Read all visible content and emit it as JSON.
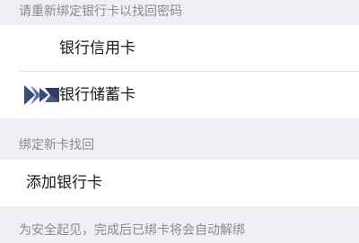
{
  "section_reset": {
    "header": "请重新绑定银行卡以找回密码",
    "items": [
      {
        "label": "银行信用卡"
      },
      {
        "label": "银行储蓄卡",
        "icon": "bank-logo-icon"
      }
    ]
  },
  "section_bind": {
    "header": "绑定新卡找回",
    "items": [
      {
        "label": "添加银行卡"
      }
    ]
  },
  "footer": {
    "note": "为安全起见，完成后已绑卡将会自动解绑"
  },
  "colors": {
    "background": "#efeff4",
    "header_text": "#8a8a8f",
    "row_text": "#1a1a1a",
    "icon_dark": "#3b4a78",
    "icon_light": "#5e70a6"
  }
}
